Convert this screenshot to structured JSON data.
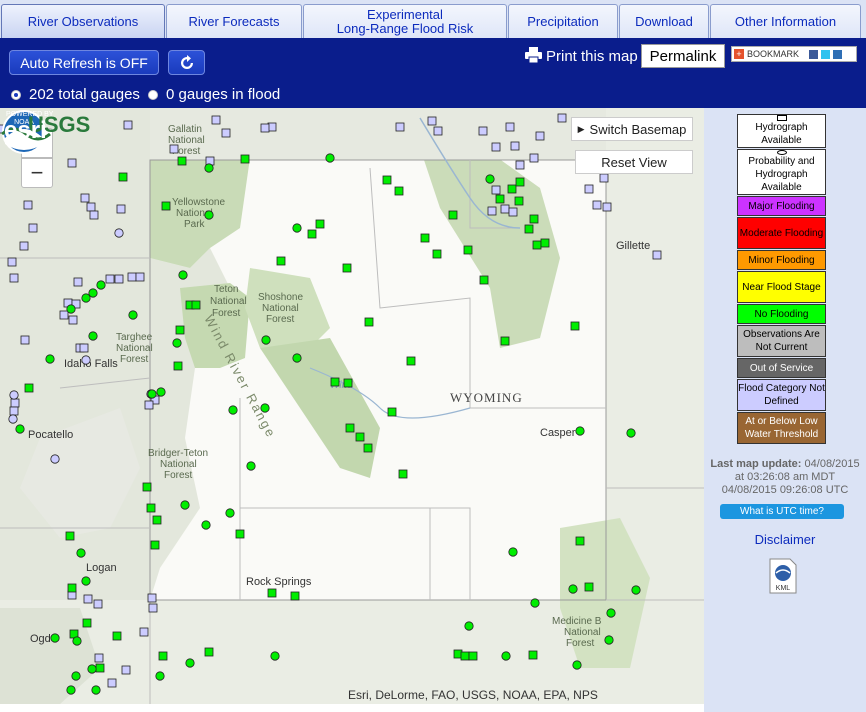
{
  "tabs": [
    {
      "label": "River Observations"
    },
    {
      "label": "River Forecasts"
    },
    {
      "label1": "Experimental",
      "label2": "Long-Range Flood Risk"
    },
    {
      "label": "Precipitation"
    },
    {
      "label": "Download"
    },
    {
      "label": "Other Information"
    }
  ],
  "header": {
    "auto_refresh": "Auto Refresh is OFF",
    "print": "Print this map",
    "permalink": "Permalink",
    "bookmark": "BOOKMARK",
    "total_gauges": "202 total gauges",
    "gauges_in_flood": "0 gauges in flood"
  },
  "map": {
    "zoom_in": "+",
    "zoom_out": "−",
    "switch_basemap": "Switch Basemap",
    "reset_view": "Reset View",
    "state_label": "WYOMING",
    "place_labels": {
      "gallatin": "Gallatin",
      "national": "National",
      "forest": "Forest",
      "yellowstone": "Yellowstone",
      "national_park1": "National",
      "park": "Park",
      "teton": "Teton",
      "shoshone": "Shoshone",
      "targhee": "Targhee",
      "idaho_falls": "Idaho Falls",
      "pocatello": "Pocatello",
      "bridger_teton": "Bridger-Teton",
      "logan": "Logan",
      "ogden": "Ogd",
      "rock_springs": "Rock Springs",
      "casper": "Casper",
      "gillette": "Gillette",
      "medicine_bow": "Medicine B",
      "wind_river": "Wind River Range",
      "riverton": "Wind"
    },
    "attribution": "Esri, DeLorme, FAO, USGS, NOAA, EPA, NPS",
    "esri_powered": "POWERED BY",
    "esri": "esri",
    "noaa": "NOAA",
    "usgs": "USGS"
  },
  "legend": {
    "items": [
      {
        "label": "Hydrograph Available",
        "color": "#ffffff",
        "symbol": "square"
      },
      {
        "label": "Probability and Hydrograph Available",
        "color": "#ffffff",
        "symbol": "circle"
      },
      {
        "label": "Major Flooding",
        "color": "#cc33ff"
      },
      {
        "label": "Moderate Flooding",
        "color": "#ff0000"
      },
      {
        "label": "Minor Flooding",
        "color": "#ff9900"
      },
      {
        "label": "Near Flood Stage",
        "color": "#ffff00"
      },
      {
        "label": "No Flooding",
        "color": "#00ff00"
      },
      {
        "label": "Observations Are Not Current",
        "color": "#bdbdbd"
      },
      {
        "label": "Out of Service",
        "color": "#666666"
      },
      {
        "label": "Flood Category Not Defined",
        "color": "#ccccff"
      },
      {
        "label": "At or Below Low Water Threshold",
        "color": "#996633"
      }
    ],
    "last_update_label": "Last map update:",
    "last_update_date": "04/08/2015",
    "last_update_time": "at 03:26:08 am MDT",
    "last_update_utc": "04/08/2015 09:26:08 UTC",
    "utc_button": "What is UTC time?",
    "disclaimer": "Disclaimer",
    "kml": "KML"
  },
  "colors": {
    "header": "#0a1d8c",
    "gauge_green": "#00ee00",
    "gauge_none": "#ccccff"
  }
}
